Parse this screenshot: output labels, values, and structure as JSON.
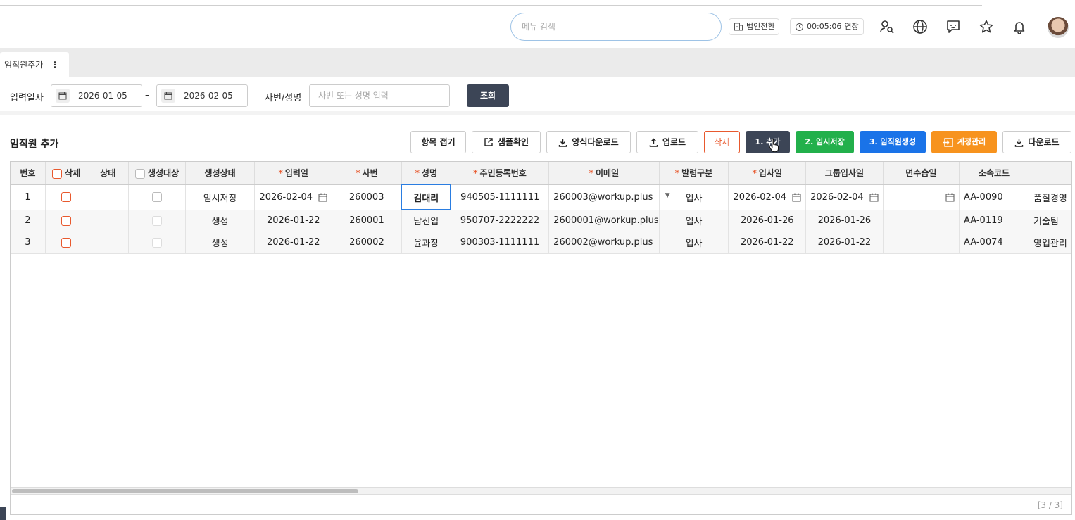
{
  "header": {
    "search_placeholder": "메뉴 검색",
    "company_switch": "법인전환",
    "session_timer": "00:05:06",
    "extend_label": "연장"
  },
  "tab": {
    "label": "임직원추가"
  },
  "filter": {
    "date_label": "입력일자",
    "date_from": "2026-01-05",
    "date_sep": "–",
    "date_to": "2026-02-05",
    "emp_label": "사번/성명",
    "emp_placeholder": "사번 또는 성명 입력",
    "query_button": "조회"
  },
  "section": {
    "title": "임직원 추가",
    "buttons": {
      "collapse": "항목 접기",
      "sample": "샘플확인",
      "form_download": "양식다운로드",
      "upload": "업로드",
      "delete": "삭제",
      "add": "1. 추가",
      "temp_save": "2. 임시저장",
      "create": "3. 임직원생성",
      "account": "계정관리",
      "download": "다운로드"
    }
  },
  "colors": {
    "primary_dark": "#3c4556",
    "green": "#22b04b",
    "blue": "#1a73e8",
    "orange": "#f7931e",
    "danger": "#e8592e"
  },
  "table": {
    "headers": {
      "no": "번호",
      "delete": "삭제",
      "status": "상태",
      "target": "생성대상",
      "gen_status": "생성상태",
      "input_date": "입력일",
      "emp_no": "사번",
      "name": "성명",
      "rrn": "주민등록번호",
      "email": "이메일",
      "order_type": "발령구분",
      "join_date": "입사일",
      "group_join": "그룹입사일",
      "probation": "면수습일",
      "dept_code": "소속코드"
    },
    "rows": [
      {
        "no": "1",
        "gen_status": "임시저장",
        "input_date": "2026-02-04",
        "emp_no": "260003",
        "name": "김대리",
        "rrn": "940505-1111111",
        "email": "260003@workup.plus",
        "order_type": "입사",
        "join_date": "2026-02-04",
        "group_join": "2026-02-04",
        "probation": "",
        "dept_code": "AA-0090",
        "dept_name": "품질경영"
      },
      {
        "no": "2",
        "gen_status": "생성",
        "input_date": "2026-01-22",
        "emp_no": "260001",
        "name": "남신입",
        "rrn": "950707-2222222",
        "email": "2600001@workup.plus",
        "order_type": "입사",
        "join_date": "2026-01-26",
        "group_join": "2026-01-26",
        "probation": "",
        "dept_code": "AA-0119",
        "dept_name": "기술팀"
      },
      {
        "no": "3",
        "gen_status": "생성",
        "input_date": "2026-01-22",
        "emp_no": "260002",
        "name": "윤과장",
        "rrn": "900303-1111111",
        "email": "260002@workup.plus",
        "order_type": "입사",
        "join_date": "2026-01-22",
        "group_join": "2026-01-22",
        "probation": "",
        "dept_code": "AA-0074",
        "dept_name": "영업관리"
      }
    ],
    "row_count": "[3 / 3]"
  }
}
